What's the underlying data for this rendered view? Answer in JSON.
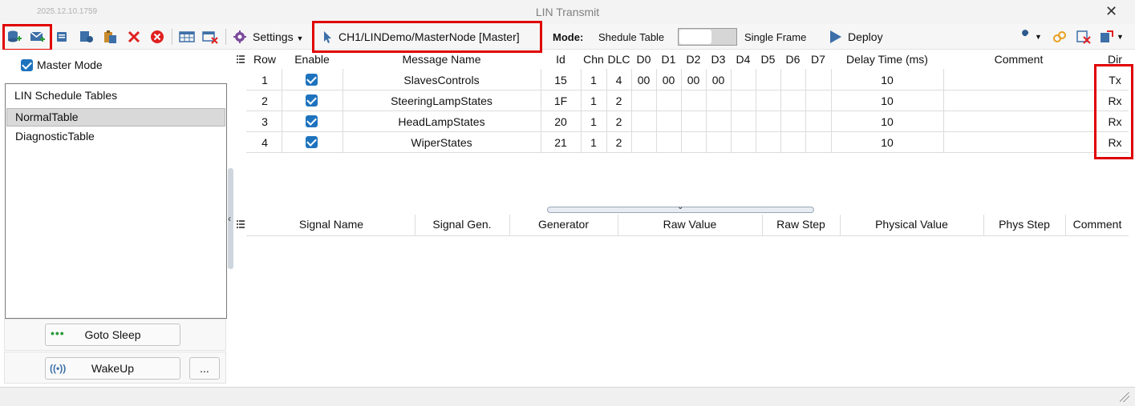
{
  "window": {
    "build": "2025.12.10.1759",
    "title": "LIN Transmit"
  },
  "toolbar": {
    "settings_label": "Settings",
    "path_label": "CH1/LINDemo/MasterNode [Master]",
    "mode_label": "Mode:",
    "mode_left": "Shedule Table",
    "mode_right": "Single Frame",
    "deploy_label": "Deploy"
  },
  "left": {
    "master_mode_label": "Master Mode",
    "schedule_title": "LIN Schedule Tables",
    "schedule_items": [
      "NormalTable",
      "DiagnosticTable"
    ],
    "goto_sleep_label": "Goto Sleep",
    "wakeup_label": "WakeUp",
    "more_label": "..."
  },
  "grid": {
    "columns": [
      "Row",
      "Enable",
      "Message Name",
      "Id",
      "Chn",
      "DLC",
      "D0",
      "D1",
      "D2",
      "D3",
      "D4",
      "D5",
      "D6",
      "D7",
      "Delay Time (ms)",
      "Comment",
      "Dir"
    ],
    "rows": [
      {
        "row": "1",
        "name": "SlavesControls",
        "id": "15",
        "chn": "1",
        "dlc": "4",
        "d0": "00",
        "d1": "00",
        "d2": "00",
        "d3": "00",
        "delay": "10",
        "dir": "Tx"
      },
      {
        "row": "2",
        "name": "SteeringLampStates",
        "id": "1F",
        "chn": "1",
        "dlc": "2",
        "d0": "",
        "d1": "",
        "d2": "",
        "d3": "",
        "delay": "10",
        "dir": "Rx"
      },
      {
        "row": "3",
        "name": "HeadLampStates",
        "id": "20",
        "chn": "1",
        "dlc": "2",
        "d0": "",
        "d1": "",
        "d2": "",
        "d3": "",
        "delay": "10",
        "dir": "Rx"
      },
      {
        "row": "4",
        "name": "WiperStates",
        "id": "21",
        "chn": "1",
        "dlc": "2",
        "d0": "",
        "d1": "",
        "d2": "",
        "d3": "",
        "delay": "10",
        "dir": "Rx"
      }
    ]
  },
  "signals": {
    "columns": [
      "Signal Name",
      "Signal Gen.",
      "Generator",
      "Raw Value",
      "Raw Step",
      "Physical Value",
      "Phys Step",
      "Comment"
    ]
  },
  "colors": {
    "accent": "#1e73be",
    "highlight": "#e00000"
  }
}
